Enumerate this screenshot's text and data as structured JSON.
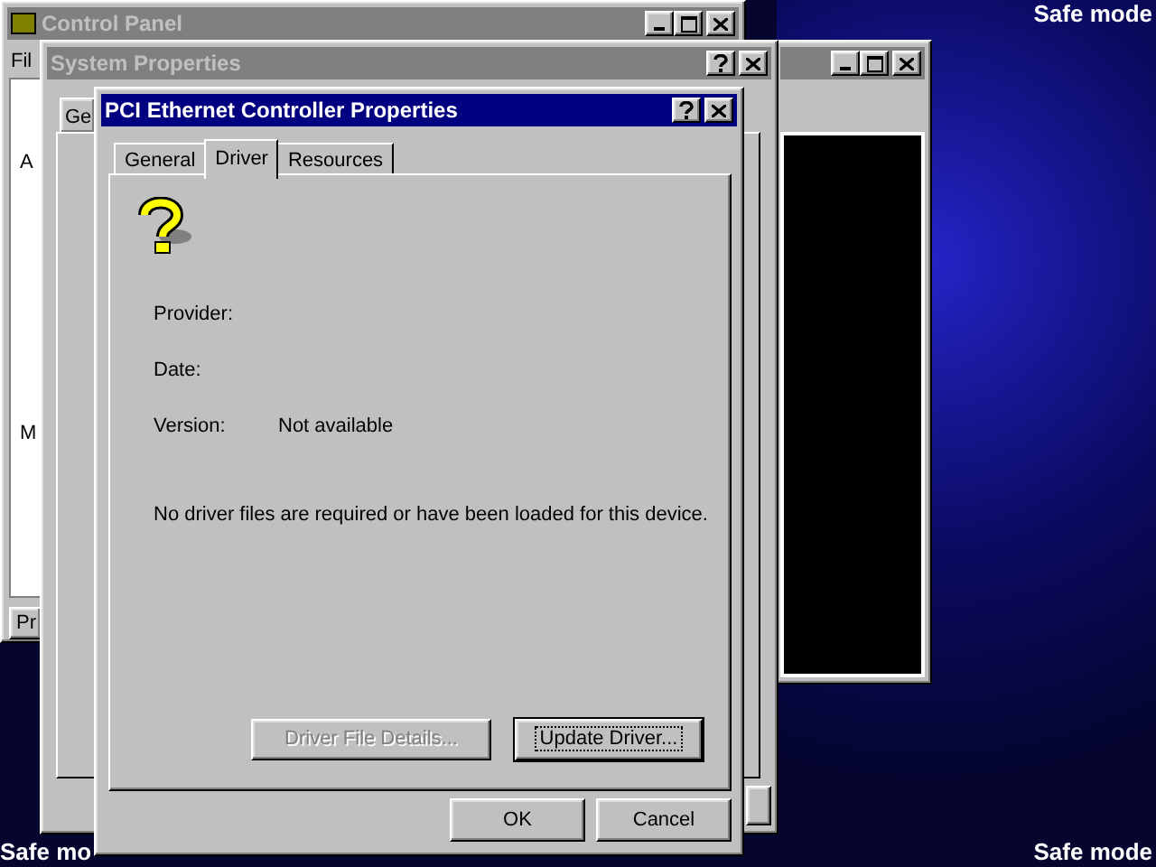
{
  "desktop": {
    "labels": [
      "Safe mode",
      "Safe mo",
      "Safe mode"
    ]
  },
  "control_panel": {
    "title": "Control Panel",
    "active": false,
    "menu": "Fil",
    "items": [
      "A",
      "M"
    ],
    "button": "Pr"
  },
  "side_window": {
    "active": false
  },
  "system_properties": {
    "title": "System Properties",
    "active": false,
    "tab": "Ge"
  },
  "dialog": {
    "title": "PCI Ethernet Controller Properties",
    "active": true,
    "tabs": [
      {
        "label": "General",
        "selected": false
      },
      {
        "label": "Driver",
        "selected": true
      },
      {
        "label": "Resources",
        "selected": false
      }
    ],
    "fields": [
      {
        "label": "Provider:"
      },
      {
        "label": "Date:"
      },
      {
        "label": "Version:",
        "value": "Not available"
      }
    ],
    "message": "No driver files are required or have been loaded for this device.",
    "panel_buttons": [
      {
        "label": "Driver File Details...",
        "disabled": true,
        "focused": false
      },
      {
        "label": "Update Driver...",
        "disabled": false,
        "focused": true
      }
    ],
    "buttons": [
      {
        "label": "OK"
      },
      {
        "label": "Cancel"
      }
    ]
  }
}
